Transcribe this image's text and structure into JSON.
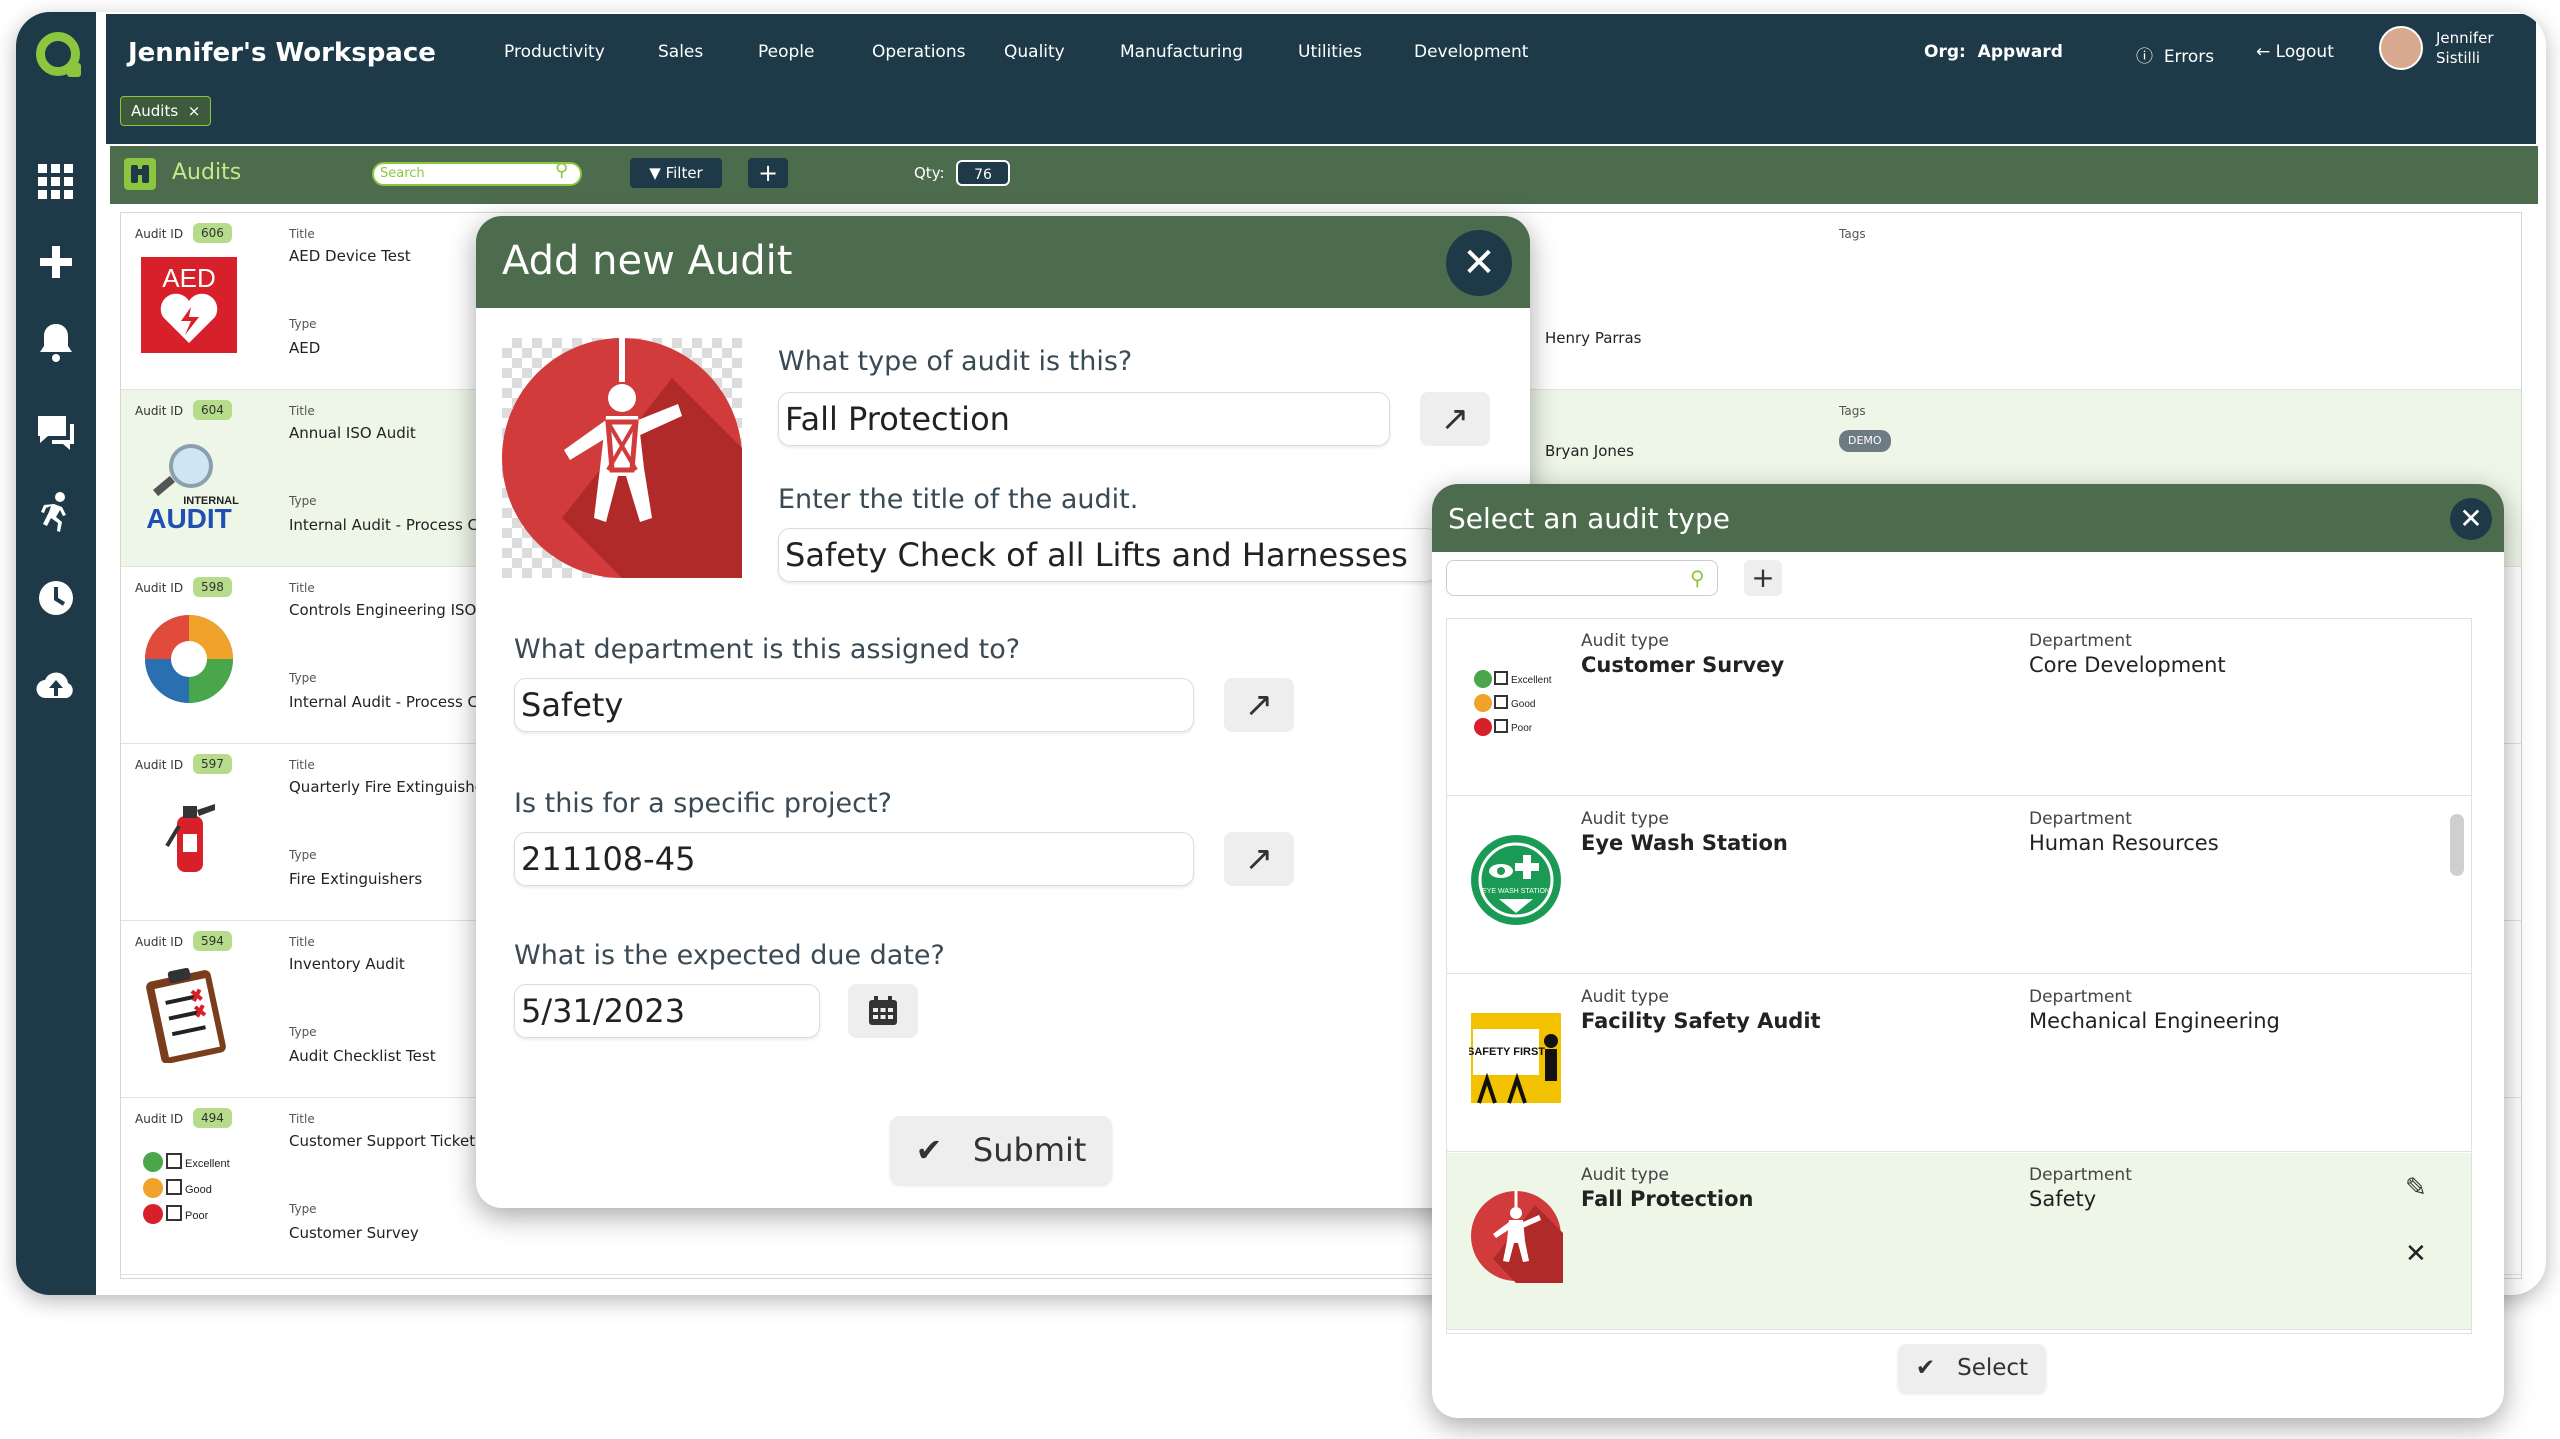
{
  "topbar": {
    "workspace": "Jennifer's Workspace",
    "nav": [
      "Productivity",
      "Sales",
      "People",
      "Operations",
      "Quality",
      "Manufacturing",
      "Utilities",
      "Development"
    ],
    "org_label": "Org:",
    "org_value": "Appward",
    "errors": "Errors",
    "logout": "Logout",
    "user_first": "Jennifer",
    "user_last": "Sistilli"
  },
  "chips": {
    "audits": "Audits"
  },
  "toolbar": {
    "title": "Audits",
    "search_placeholder": "Search",
    "filter": "Filter",
    "qty_label": "Qty:",
    "qty_value": "76"
  },
  "audit_rows": [
    {
      "id_label": "Audit ID",
      "id": "606",
      "title_label": "Title",
      "title": "AED Device Test",
      "type_label": "Type",
      "type": "AED",
      "tags_label": "Tags",
      "assigned": "Henry Parras"
    },
    {
      "id_label": "Audit ID",
      "id": "604",
      "title_label": "Title",
      "title": "Annual ISO Audit",
      "type_label": "Type",
      "type": "Internal Audit - Process Con",
      "tags_label": "Tags",
      "tag": "DEMO",
      "assigned": "Bryan Jones"
    },
    {
      "id_label": "Audit ID",
      "id": "598",
      "title_label": "Title",
      "title": "Controls Engineering ISO Pre",
      "type_label": "Type",
      "type": "Internal Audit - Process Con"
    },
    {
      "id_label": "Audit ID",
      "id": "597",
      "title_label": "Title",
      "title": "Quarterly Fire Extinguisher C",
      "type_label": "Type",
      "type": "Fire Extinguishers"
    },
    {
      "id_label": "Audit ID",
      "id": "594",
      "title_label": "Title",
      "title": "Inventory Audit",
      "type_label": "Type",
      "type": "Audit Checklist Test"
    },
    {
      "id_label": "Audit ID",
      "id": "494",
      "title_label": "Title",
      "title": "Customer Support Ticket Pro",
      "type_label": "Type",
      "type": "Customer Survey"
    }
  ],
  "thumb_text": {
    "aed": "AED",
    "internal": "INTERNAL",
    "audit": "AUDIT"
  },
  "add_audit": {
    "title": "Add new Audit",
    "q_type": "What type of audit is this?",
    "type_value": "Fall Protection",
    "q_title": "Enter the title of the audit.",
    "title_value": "Safety Check of all Lifts and Harnesses",
    "q_department": "What department is this assigned to?",
    "department_value": "Safety",
    "q_project": "Is this for a specific project?",
    "project_value": "211108-45",
    "q_due": "What is the expected due date?",
    "due_value": "5/31/2023",
    "submit": "Submit"
  },
  "select_type": {
    "title": "Select an audit type",
    "select": "Select",
    "items": [
      {
        "type_label": "Audit type",
        "type": "Customer Survey",
        "dept_label": "Department",
        "dept": "Core Development"
      },
      {
        "type_label": "Audit type",
        "type": "Eye Wash Station",
        "dept_label": "Department",
        "dept": "Human Resources"
      },
      {
        "type_label": "Audit type",
        "type": "Facility Safety Audit",
        "dept_label": "Department",
        "dept": "Mechanical Engineering"
      },
      {
        "type_label": "Audit type",
        "type": "Fall Protection",
        "dept_label": "Department",
        "dept": "Safety"
      }
    ],
    "survey_labels": [
      "Excellent",
      "Good",
      "Poor"
    ],
    "eye_wash_text": "EYE WASH STATION",
    "safety_first": "SAFETY FIRST"
  },
  "colors": {
    "navy": "#1e3a48",
    "green_dark": "#4d6b4d",
    "accent": "#8cc63f",
    "selected_row": "#eef6e8",
    "red": "#d23b3b"
  }
}
